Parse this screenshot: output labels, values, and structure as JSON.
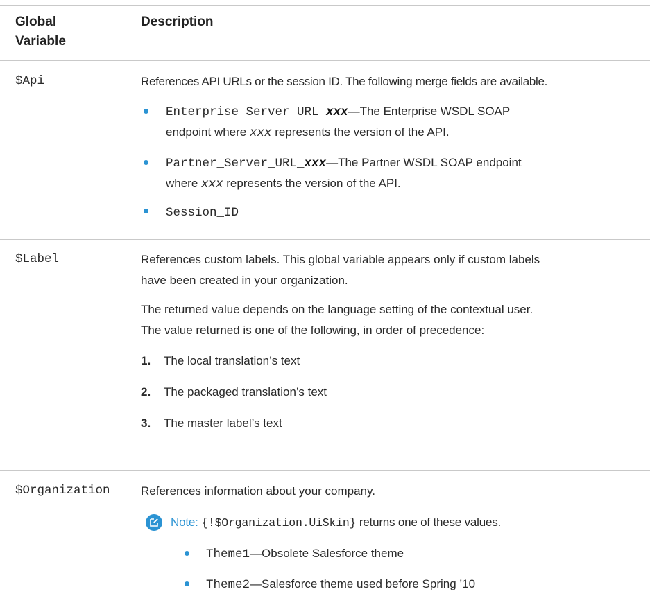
{
  "table": {
    "headers": {
      "variable_line1": "Global",
      "variable_line2": "Variable",
      "description": "Description"
    },
    "rows": {
      "api": {
        "variable": "$Api",
        "intro": "References API URLs or the session ID. The following merge fields are available.",
        "items": [
          {
            "code": "Enterprise_Server_URL_",
            "code_var": "xxx",
            "dash": "—",
            "line1_text": "The Enterprise WSDL SOAP",
            "line2_prefix": "endpoint where ",
            "line2_var": "xxx",
            "line2_suffix": " represents the version of the API."
          },
          {
            "code": "Partner_Server_URL_",
            "code_var": "xxx",
            "dash": "—",
            "line1_text": "The Partner WSDL SOAP endpoint",
            "line2_prefix": "where ",
            "line2_var": "xxx",
            "line2_suffix": " represents the version of the API."
          },
          {
            "code": "Session_ID"
          }
        ]
      },
      "label": {
        "variable": "$Label",
        "para1_line1": "References custom labels. This global variable appears only if custom labels",
        "para1_line2": "have been created in your organization.",
        "para2_line1": "The returned value depends on the language setting of the contextual user.",
        "para2_line2": "The value returned is one of the following, in order of precedence:",
        "items": [
          {
            "num": "1.",
            "text": "The local translation’s text"
          },
          {
            "num": "2.",
            "text": "The packaged translation’s text"
          },
          {
            "num": "3.",
            "text": "The master label’s text"
          }
        ]
      },
      "organization": {
        "variable": "$Organization",
        "intro": "References information about your company.",
        "note": {
          "label": "Note:",
          "code": "{!$Organization.UiSkin}",
          "text": "returns one of these values.",
          "icon": "edit-note-icon",
          "items": [
            {
              "code": "Theme1",
              "dash": "—",
              "text": "Obsolete Salesforce theme"
            },
            {
              "code": "Theme2",
              "dash": "—",
              "text": "Salesforce theme used before Spring ’10"
            }
          ]
        }
      }
    }
  },
  "colors": {
    "accent": "#2b93d3",
    "rule": "#c9c9c9",
    "text": "#2a2a2a"
  }
}
